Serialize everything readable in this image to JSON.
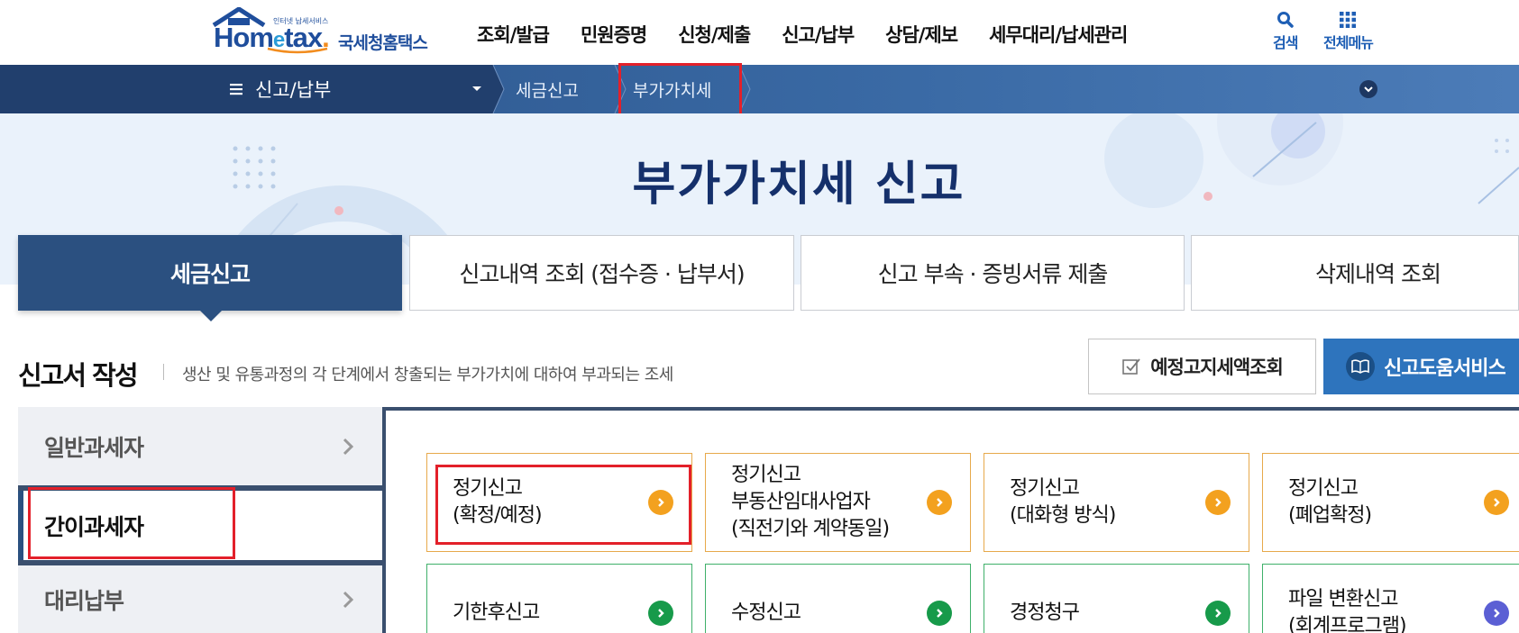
{
  "header": {
    "logo": {
      "tiny": "인터넷 납세서비스",
      "brand_prefix": "Hom",
      "brand_e": "e",
      "brand_suffix": "tax",
      "brand_dot": ".",
      "korean": "국세청홈택스"
    },
    "nav": [
      "조회/발급",
      "민원증명",
      "신청/제출",
      "신고/납부",
      "상담/제보",
      "세무대리/납세관리"
    ],
    "search_label": "검색",
    "allmenu_label": "전체메뉴"
  },
  "location": {
    "menu_label": "신고/납부",
    "crumbs": [
      "세금신고",
      "부가가치세"
    ]
  },
  "hero": {
    "title": "부가가치세 신고"
  },
  "tabs": [
    "세금신고",
    "신고내역 조회 (접수증 · 납부서)",
    "신고 부속 · 증빙서류 제출",
    "삭제내역 조회"
  ],
  "section": {
    "title": "신고서 작성",
    "description": "생산 및 유통과정의 각 단계에서 창출되는 부가가치에 대하여 부과되는 조세",
    "btn_estimate": "예정고지세액조회",
    "btn_help": "신고도움서비스"
  },
  "sidebar": {
    "items": [
      "일반과세자",
      "간이과세자",
      "대리납부"
    ]
  },
  "cards": {
    "row1": [
      {
        "line1": "정기신고",
        "line2": "(확정/예정)",
        "line3": ""
      },
      {
        "line1": "정기신고",
        "line2": "부동산임대사업자",
        "line3": "(직전기와 계약동일)"
      },
      {
        "line1": "정기신고",
        "line2": "(대화형 방식)",
        "line3": ""
      },
      {
        "line1": "정기신고",
        "line2": "(폐업확정)",
        "line3": ""
      }
    ],
    "row2": [
      {
        "line1": "기한후신고",
        "line2": ""
      },
      {
        "line1": "수정신고",
        "line2": ""
      },
      {
        "line1": "경정청구",
        "line2": ""
      },
      {
        "line1": "파일 변환신고",
        "line2": "(회계프로그램)"
      }
    ]
  },
  "colors": {
    "primary_navy": "#2b5080",
    "brand_blue": "#1f4e9c",
    "highlight_red": "#e3202a",
    "orange": "#f3a11f",
    "green": "#179a4a",
    "purple": "#5b5fd4"
  },
  "icons": [
    "search-icon",
    "grid-menu-icon",
    "hamburger-icon",
    "caret-down-icon",
    "chevron-right-icon",
    "circle-arrow-icon",
    "checkbox-icon",
    "book-icon"
  ]
}
